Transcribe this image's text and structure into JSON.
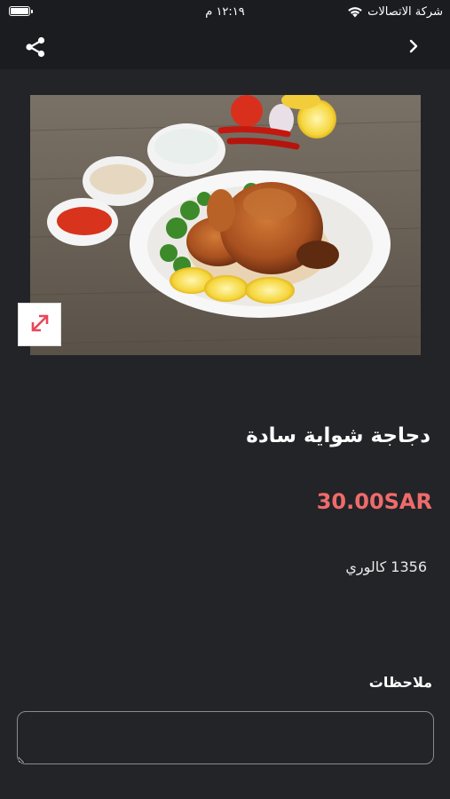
{
  "status_bar": {
    "carrier": "شركة الاتصالات",
    "time": "١٢:١٩ م",
    "wifi_icon": "wifi-icon",
    "battery_icon": "battery-icon"
  },
  "nav": {
    "back_icon": "chevron-right-icon",
    "share_icon": "share-icon"
  },
  "product": {
    "image_alt": "roast chicken plate",
    "title": "دجاجة شواية سادة",
    "price": "30.00SAR",
    "calories": "1356 كالوري",
    "expand_icon": "expand-icon"
  },
  "notes": {
    "label": "ملاحظات",
    "value": "",
    "placeholder": ""
  },
  "colors": {
    "background": "#232428",
    "bar": "#1b1c1f",
    "price": "#ef6b6b",
    "expand_arrow": "#e8475a"
  }
}
